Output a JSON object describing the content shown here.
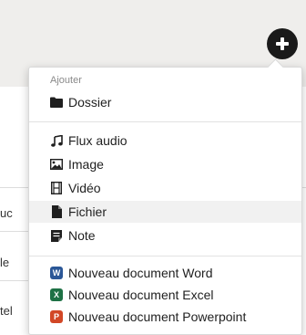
{
  "background": {
    "partial_texts": [
      "uc",
      "le",
      "tel"
    ]
  },
  "menu": {
    "section_header": "Ajouter",
    "items": [
      {
        "label": "Dossier",
        "icon": "folder-icon"
      },
      {
        "label": "Flux audio",
        "icon": "music-note-icon"
      },
      {
        "label": "Image",
        "icon": "image-icon"
      },
      {
        "label": "Vidéo",
        "icon": "film-icon"
      },
      {
        "label": "Fichier",
        "icon": "file-icon"
      },
      {
        "label": "Note",
        "icon": "note-icon"
      },
      {
        "label": "Nouveau document Word",
        "icon": "word-icon",
        "badge": "W",
        "color": "#2b5797"
      },
      {
        "label": "Nouveau document Excel",
        "icon": "excel-icon",
        "badge": "X",
        "color": "#1e7145"
      },
      {
        "label": "Nouveau document Powerpoint",
        "icon": "powerpoint-icon",
        "badge": "P",
        "color": "#d24726"
      }
    ]
  },
  "colors": {
    "top_band": "#efeeec",
    "add_button": "#1a1a1a",
    "highlight": "#f1f1f1"
  }
}
